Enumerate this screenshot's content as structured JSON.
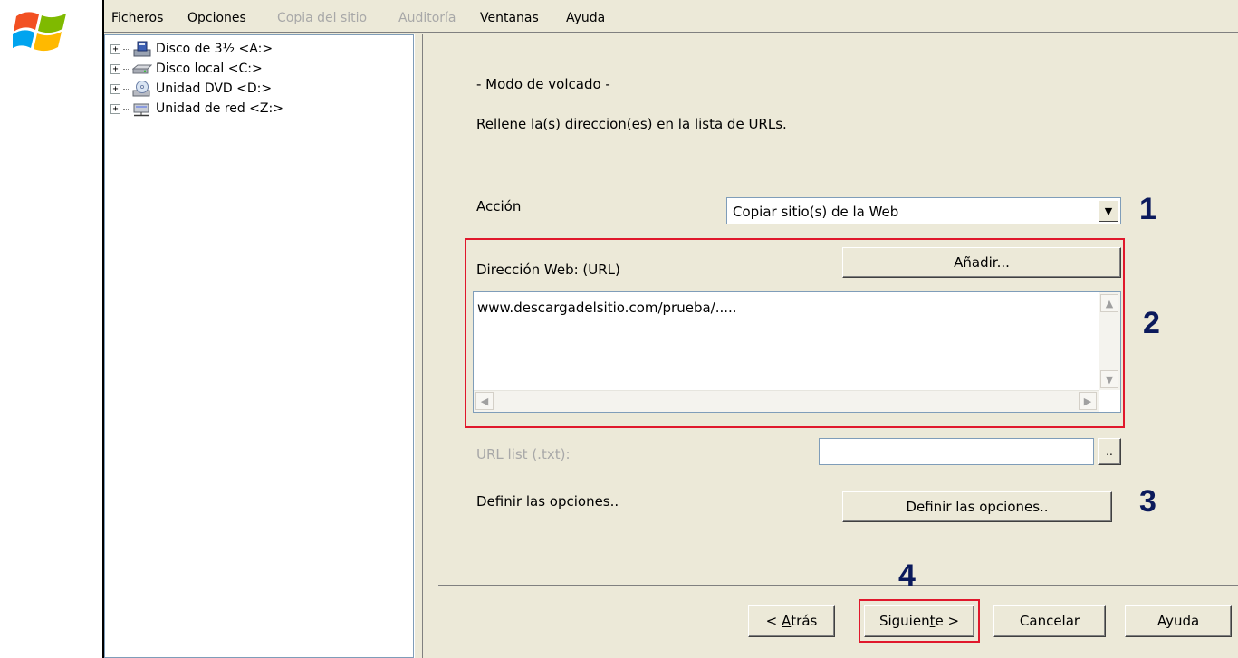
{
  "menu": {
    "items": [
      {
        "label": "Ficheros",
        "enabled": true
      },
      {
        "label": "Opciones",
        "enabled": true
      },
      {
        "label": "Copia del sitio",
        "enabled": false
      },
      {
        "label": "Auditoría",
        "enabled": false
      },
      {
        "label": "Ventanas",
        "enabled": true
      },
      {
        "label": "Ayuda",
        "enabled": true
      }
    ]
  },
  "tree": {
    "items": [
      {
        "label": "Disco de 3½ <A:>",
        "icon": "floppy-drive-icon"
      },
      {
        "label": "Disco local <C:>",
        "icon": "hard-drive-icon"
      },
      {
        "label": "Unidad DVD <D:>",
        "icon": "dvd-drive-icon"
      },
      {
        "label": "Unidad de red <Z:>",
        "icon": "network-drive-icon"
      }
    ],
    "expander": "+"
  },
  "wizard": {
    "mode_title": "- Modo de volcado -",
    "instruction": "Rellene la(s) direccion(es) en la lista de URLs.",
    "action_label": "Acción",
    "action_value": "Copiar sitio(s) de la Web",
    "url_label": "Dirección Web: (URL)",
    "add_button": "Añadir...",
    "url_text": "www.descargadelsitio.com/prueba/.....",
    "url_list_label": "URL list (.txt):",
    "url_list_value": "",
    "browse_button": "..",
    "options_label": "Definir las opciones..",
    "options_button": "Definir las opciones.."
  },
  "footer": {
    "back_prefix": "< ",
    "back_accel": "A",
    "back_rest": "trás",
    "next_pre": "Siguien",
    "next_accel": "t",
    "next_post": "e >",
    "cancel": "Cancelar",
    "help": "Ayuda"
  },
  "annotations": {
    "n1": "1",
    "n2": "2",
    "n3": "3",
    "n4": "4"
  },
  "colors": {
    "highlight_border": "#e0182c",
    "annotation_number": "#0b1a5c",
    "window_face": "#ece9d8"
  }
}
